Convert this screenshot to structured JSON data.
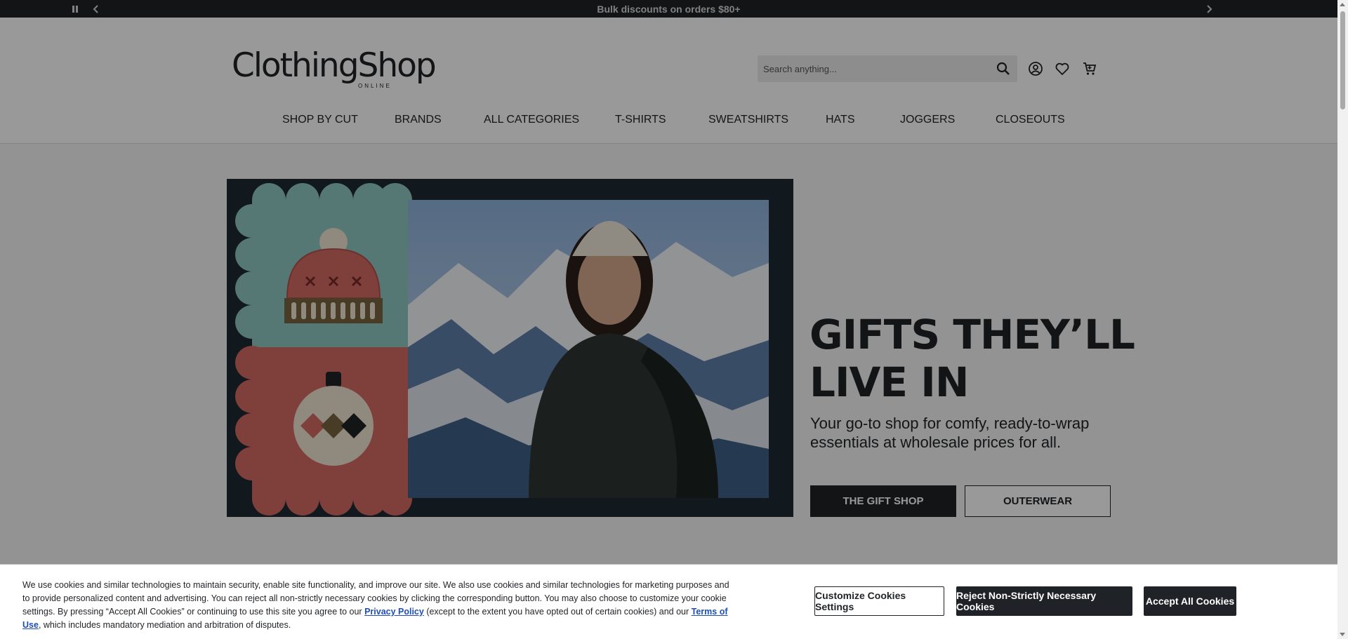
{
  "announcement": {
    "text": "Bulk discounts on orders $80+",
    "pause_icon": "pause-icon",
    "prev_icon": "chevron-left-icon",
    "next_icon": "chevron-right-icon"
  },
  "header": {
    "logo_text": "ClothingShop",
    "logo_sub": "ONLINE",
    "search_placeholder": "Search anything...",
    "icons": [
      "search-icon",
      "account-icon",
      "heart-icon",
      "cart-icon"
    ]
  },
  "nav": {
    "items": [
      {
        "label": "SHOP BY CUT"
      },
      {
        "label": "BRANDS"
      },
      {
        "label": "ALL CATEGORIES"
      },
      {
        "label": "T-SHIRTS"
      },
      {
        "label": "SWEATSHIRTS"
      },
      {
        "label": "HATS"
      },
      {
        "label": "JOGGERS"
      },
      {
        "label": "CLOSEOUTS"
      }
    ]
  },
  "hero": {
    "title_line1": "GIFTS THEY’LL",
    "title_line2": "LIVE IN",
    "subtitle": "Your go-to shop for comfy, ready-to-wrap essentials at wholesale prices for all.",
    "primary_button": "THE GIFT SHOP",
    "secondary_button": "OUTERWEAR",
    "colors": {
      "teal": "#8fc8c4",
      "red": "#d46a63",
      "dark": "#1f2a33",
      "cream": "#f1e4d3"
    }
  },
  "cookie": {
    "text_part1": "We use cookies and similar technologies to maintain security, enable site functionality, and improve our site. We also use cookies and similar technologies for marketing purposes and to provide personalized content and advertising. You can reject all non-strictly necessary cookies by clicking the corresponding button. You may also choose to customize your cookie settings. By pressing “Accept All Cookies” or continuing to use this site you agree to our ",
    "privacy_link": "Privacy Policy",
    "text_part2": " (except to the extent you have opted out of certain cookies) and our ",
    "terms_link": "Terms of Use",
    "text_part3": ", which includes mandatory mediation and arbitration of disputes.",
    "customize_button": "Customize Cookies Settings",
    "reject_button": "Reject Non-Strictly Necessary Cookies",
    "accept_button": "Accept All Cookies"
  }
}
